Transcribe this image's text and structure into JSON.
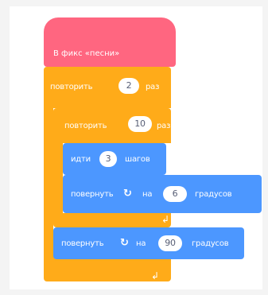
{
  "hat": {
    "label": "В фикс «песни»",
    "color": "#ff6680"
  },
  "outer_repeat": {
    "label": "повторить",
    "value": "2",
    "suffix": "раз",
    "color": "#ffab19"
  },
  "inner_repeat": {
    "label": "повторить",
    "value": "10",
    "suffix": "раз",
    "color": "#ffab19"
  },
  "move": {
    "label": "идти",
    "value": "3",
    "suffix": "шагов",
    "color": "#4c97ff"
  },
  "turn_inner": {
    "label": "повернуть",
    "on": "на",
    "value": "6",
    "suffix": "градусов",
    "icon": "rotate-cw-icon"
  },
  "turn_outer": {
    "label": "повернуть",
    "on": "на",
    "value": "90",
    "suffix": "градусов",
    "icon": "rotate-cw-icon"
  },
  "loop_arrow": "↲"
}
